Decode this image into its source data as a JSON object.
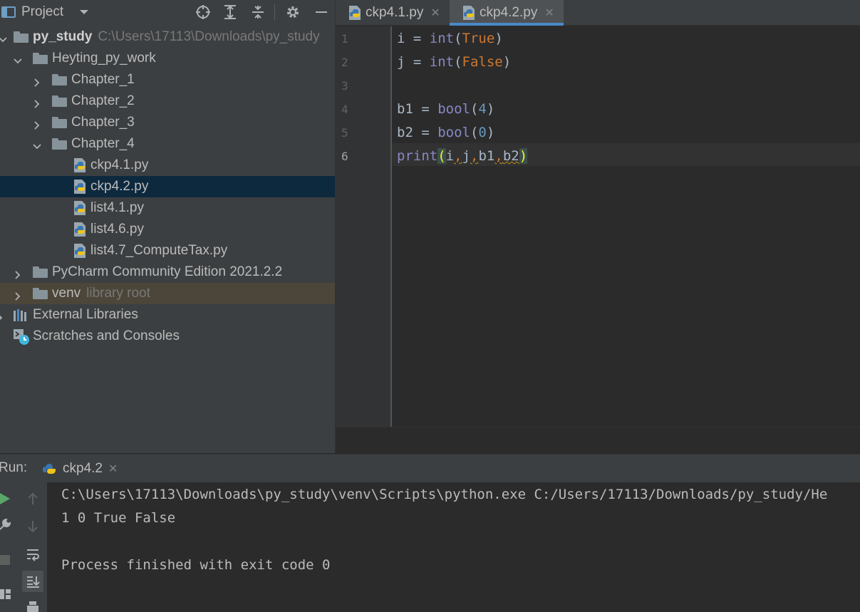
{
  "project_panel": {
    "title": "Project",
    "tree": [
      {
        "label": "py_study",
        "hint": "C:\\Users\\17113\\Downloads\\py_study"
      },
      {
        "label": "Heyting_py_work"
      },
      {
        "label": "Chapter_1"
      },
      {
        "label": "Chapter_2"
      },
      {
        "label": "Chapter_3"
      },
      {
        "label": "Chapter_4"
      },
      {
        "label": "ckp4.1.py"
      },
      {
        "label": "ckp4.2.py"
      },
      {
        "label": "list4.1.py"
      },
      {
        "label": "list4.6.py"
      },
      {
        "label": "list4.7_ComputeTax.py"
      },
      {
        "label": "PyCharm Community Edition 2021.2.2"
      },
      {
        "label": "venv",
        "hint": "library root"
      },
      {
        "label": "External Libraries"
      },
      {
        "label": "Scratches and Consoles"
      }
    ]
  },
  "editor": {
    "tabs": [
      {
        "label": "ckp4.1.py"
      },
      {
        "label": "ckp4.2.py",
        "active": true
      }
    ],
    "line_numbers": [
      "1",
      "2",
      "3",
      "4",
      "5",
      "6"
    ],
    "code": {
      "l1": {
        "var": "i = ",
        "fn": "int",
        "open": "(",
        "arg": "True",
        "close": ")"
      },
      "l2": {
        "var": "j = ",
        "fn": "int",
        "open": "(",
        "arg": "False",
        "close": ")"
      },
      "l4": {
        "var": "b1 = ",
        "fn": "bool",
        "open": "(",
        "arg": "4",
        "close": ")"
      },
      "l5": {
        "var": "b2 = ",
        "fn": "bool",
        "open": "(",
        "arg": "0",
        "close": ")"
      },
      "l6": {
        "fn": "print",
        "open": "(",
        "a1": "i",
        "c1": ",",
        "a2": "j",
        "c2": ",",
        "a3": "b1",
        "c3": ",",
        "a4": "b2",
        "close": ")"
      }
    }
  },
  "run_panel": {
    "label": "Run:",
    "tab_label": "ckp4.2",
    "console": [
      "C:\\Users\\17113\\Downloads\\py_study\\venv\\Scripts\\python.exe C:/Users/17113/Downloads/py_study/He",
      "1 0 True False",
      "",
      "Process finished with exit code 0"
    ]
  },
  "colors": {
    "selection": "#0d293e",
    "tab_underline": "#4a88c7",
    "keyword_orange": "#cc7832",
    "builtin_purple": "#8888c6",
    "number_blue": "#6897bb"
  }
}
